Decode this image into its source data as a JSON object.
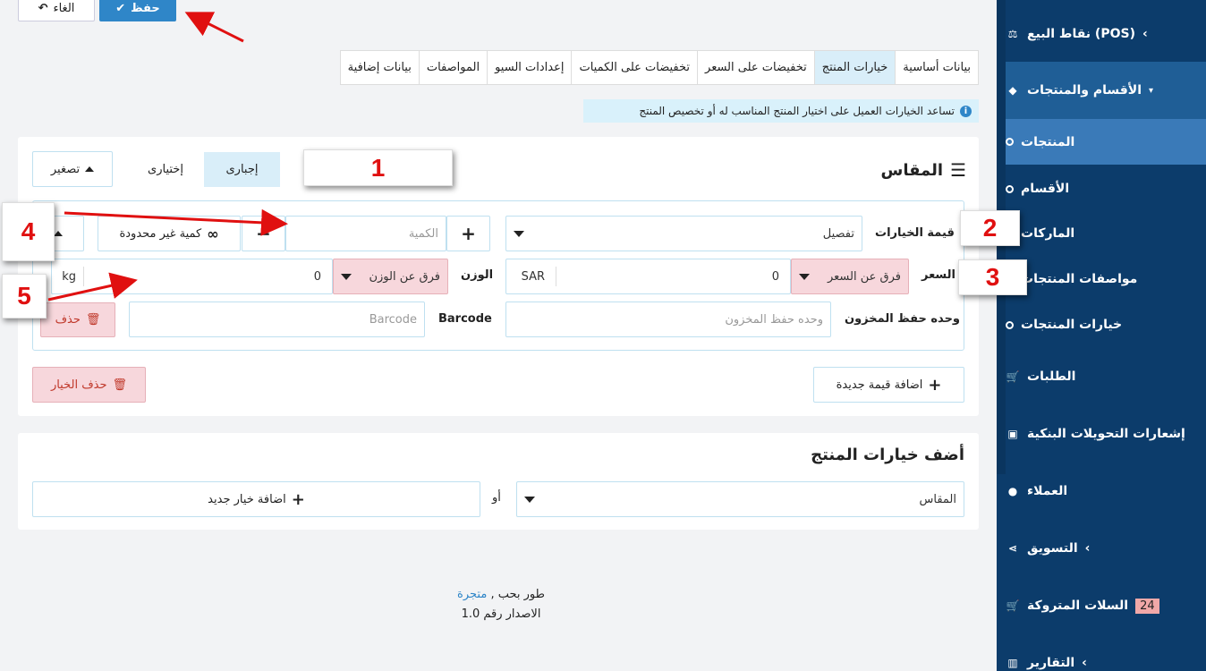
{
  "toolbar": {
    "save_label": "حفظ",
    "cancel_label": "الغاء"
  },
  "tabs": [
    "بيانات أساسية",
    "خيارات المنتج",
    "تخفيضات على السعر",
    "تخفيضات على الكميات",
    "إعدادات السيو",
    "المواصفات",
    "بيانات إضافية"
  ],
  "info_text": "تساعد الخيارات العميل على اختيار المنتج المناسب له أو تخصيص المنتج",
  "option": {
    "title": "المقاس",
    "required_label": "إجبارى",
    "optional_label": "إختيارى",
    "collapse_label": "تصغير",
    "value_label": "قيمة الخيارات",
    "value_selected": "تفصيل",
    "quantity_placeholder": "الكمية",
    "unlimited_label": "كمية غير محدودة",
    "price_label": "السعر",
    "price_diff_label": "فرق عن السعر",
    "price_value": "0",
    "currency": "SAR",
    "weight_label": "الوزن",
    "weight_diff_label": "فرق عن الوزن",
    "weight_value": "0",
    "weight_unit": "kg",
    "sku_label": "وحده حفظ المخزون",
    "sku_placeholder": "وحده حفظ المخزون",
    "barcode_label": "Barcode",
    "barcode_placeholder": "Barcode",
    "delete_label": "حذف",
    "add_value_label": "اضافة قيمة جديدة",
    "delete_option_label": "حذف الخيار"
  },
  "add_option": {
    "title": "أضف خيارات المنتج",
    "select_value": "المقاس",
    "or_label": "أو",
    "new_option_label": "اضافة خيار جديد"
  },
  "footer": {
    "dev_text": "طور بحب ,",
    "dev_link": "متجرة",
    "version": "الاصدار رقم 1.0"
  },
  "sidebar": {
    "pos": "نقاط البيع (POS)",
    "categories_products": "الأقسام والمنتجات",
    "products": "المنتجات",
    "categories": "الأقسام",
    "brands": "الماركات",
    "specs": "مواصفات المنتجات",
    "options": "خيارات المنتجات",
    "orders": "الطلبات",
    "transfers": "إشعارات التحويلات البنكية",
    "customers": "العملاء",
    "marketing": "التسويق",
    "abandoned": "السلات المتروكة",
    "abandoned_count": "24",
    "reports": "التقارير"
  },
  "callouts": [
    "1",
    "2",
    "3",
    "4",
    "5"
  ]
}
